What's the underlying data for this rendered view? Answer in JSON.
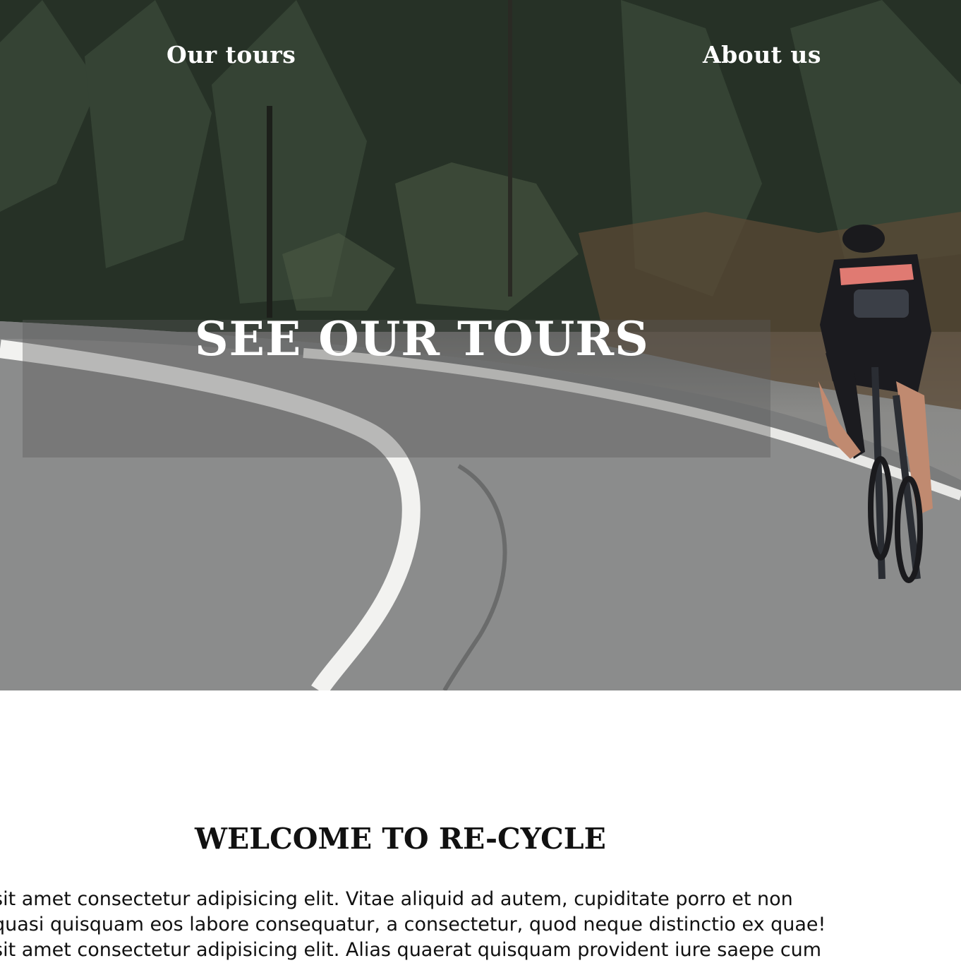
{
  "nav": {
    "tours_label": "Our tours",
    "about_label": "About us"
  },
  "hero": {
    "cta_label": "SEE OUR TOURS",
    "background_image": "cyclist-on-forest-road-photo"
  },
  "welcome": {
    "title": "WELCOME TO RE-CYCLE",
    "lines": [
      "sit amet consectetur adipisicing elit. Vitae aliquid ad autem, cupiditate porro et non",
      "quasi quisquam eos labore consequatur, a consectetur, quod neque distinctio ex quae!",
      "sit amet consectetur adipisicing elit. Alias quaerat quisquam provident iure saepe cum"
    ]
  },
  "colors": {
    "nav_text": "#ffffff",
    "body_text": "#111111",
    "page_bg": "#ffffff"
  }
}
